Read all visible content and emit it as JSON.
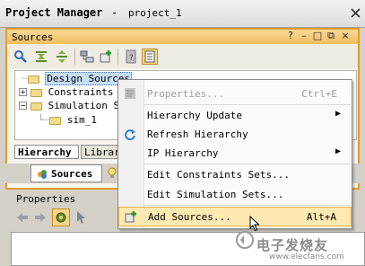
{
  "window": {
    "title": "Project Manager",
    "project": "project_1"
  },
  "sources_panel": {
    "title": "Sources",
    "header_buttons": [
      "?",
      "–",
      "□",
      "⧉",
      "×"
    ],
    "tree": [
      {
        "label": "Design Sources",
        "selected": true
      },
      {
        "label": "Constraints",
        "expanded": false
      },
      {
        "label": "Simulation Sou",
        "expanded": true
      },
      {
        "label": "sim_1"
      }
    ],
    "tabs": [
      "Hierarchy",
      "Librar"
    ]
  },
  "bottom_tabs": [
    {
      "label": "Sources"
    }
  ],
  "properties_panel": {
    "title": "Properties"
  },
  "context_menu": {
    "items": [
      {
        "label": "Properties...",
        "shortcut": "Ctrl+E",
        "disabled": true,
        "icon": "properties-icon"
      },
      {
        "label": "Hierarchy Update",
        "submenu": true
      },
      {
        "label": "Refresh Hierarchy",
        "icon": "refresh-icon"
      },
      {
        "label": "IP Hierarchy",
        "submenu": true
      },
      {
        "label": "Edit Constraints Sets..."
      },
      {
        "label": "Edit Simulation Sets..."
      },
      {
        "label": "Add Sources...",
        "shortcut": "Alt+A",
        "hovered": true,
        "icon": "add-sources-icon"
      }
    ]
  },
  "watermark": {
    "text": "电子发烧友",
    "url": "www.elecfans.com"
  },
  "colors": {
    "accent": "#e39b2b",
    "panel_header": "#f1bd5e",
    "selection": "#c6dff7",
    "menu_hover": "#fde9b1"
  }
}
